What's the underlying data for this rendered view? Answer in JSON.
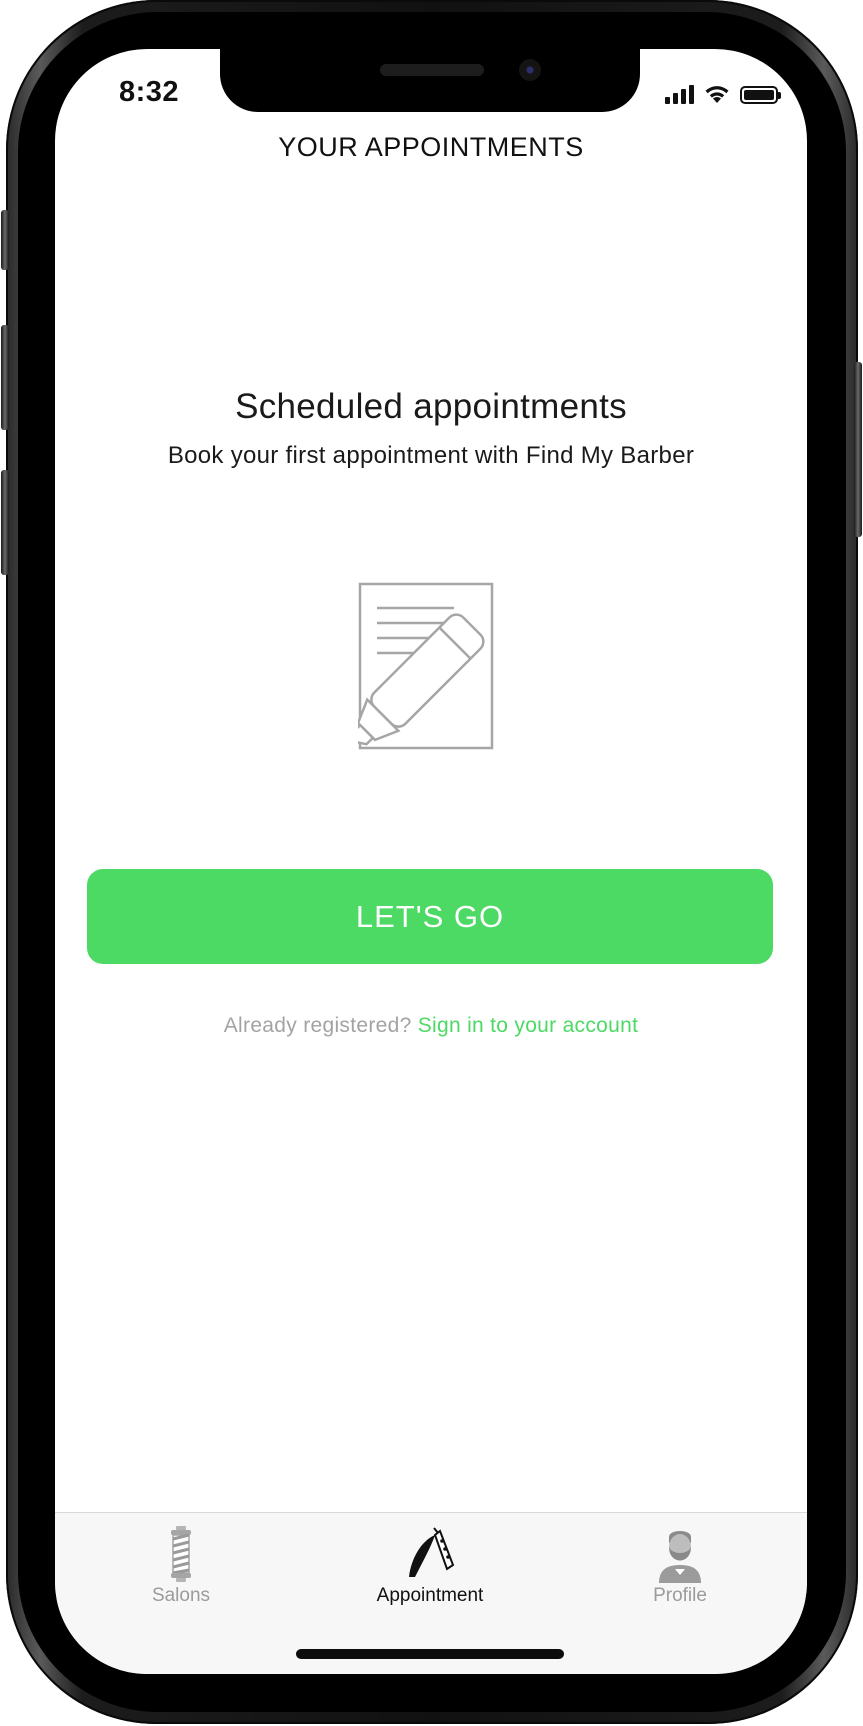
{
  "status_bar": {
    "time": "8:32",
    "signal_icon": "cellular-signal-icon",
    "wifi_icon": "wifi-icon",
    "battery_icon": "battery-icon",
    "battery_level": 1.0
  },
  "header": {
    "title": "YOUR APPOINTMENTS"
  },
  "empty_state": {
    "heading": "Scheduled appointments",
    "subheading": "Book your first appointment with Find My Barber",
    "illustration_icon": "document-pencil-icon",
    "cta_label": "LET'S GO",
    "signin_prefix": "Already registered?",
    "signin_link": "Sign in to your account"
  },
  "tabbar": {
    "active_index": 1,
    "tabs": [
      {
        "label": "Salons",
        "icon": "barber-pole-icon"
      },
      {
        "label": "Appointment",
        "icon": "straight-razor-icon"
      },
      {
        "label": "Profile",
        "icon": "bearded-man-icon"
      }
    ]
  },
  "colors": {
    "accent": "#4cd964",
    "text": "#111111",
    "muted": "#9b9b9b",
    "tabbar_bg": "#f7f7f7"
  }
}
